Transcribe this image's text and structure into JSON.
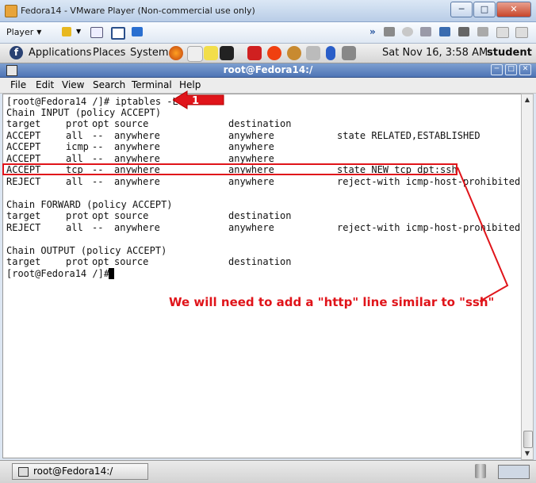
{
  "vm_window": {
    "title": "Fedora14 - VMware Player (Non-commercial use only)"
  },
  "vm_toolbar": {
    "player_label": "Player"
  },
  "panel": {
    "applications": "Applications",
    "places": "Places",
    "system": "System",
    "clock": "Sat Nov 16,  3:58 AM",
    "user": "student"
  },
  "terminal": {
    "title": "root@Fedora14:/",
    "menu": [
      "File",
      "Edit",
      "View",
      "Search",
      "Terminal",
      "Help"
    ],
    "command_line": "[root@Fedora14 /]# iptables -L",
    "prompt": "[root@Fedora14 /]# ",
    "chains": [
      {
        "header": "Chain INPUT (policy ACCEPT)",
        "columns": [
          "target",
          "prot",
          "opt",
          "source",
          "destination"
        ],
        "rows": [
          [
            "ACCEPT",
            "all",
            "--",
            "anywhere",
            "anywhere",
            "state RELATED,ESTABLISHED"
          ],
          [
            "ACCEPT",
            "icmp",
            "--",
            "anywhere",
            "anywhere",
            ""
          ],
          [
            "ACCEPT",
            "all",
            "--",
            "anywhere",
            "anywhere",
            ""
          ],
          [
            "ACCEPT",
            "tcp",
            "--",
            "anywhere",
            "anywhere",
            "state NEW tcp dpt:ssh"
          ],
          [
            "REJECT",
            "all",
            "--",
            "anywhere",
            "anywhere",
            "reject-with icmp-host-prohibited"
          ]
        ]
      },
      {
        "header": "Chain FORWARD (policy ACCEPT)",
        "columns": [
          "target",
          "prot",
          "opt",
          "source",
          "destination"
        ],
        "rows": [
          [
            "REJECT",
            "all",
            "--",
            "anywhere",
            "anywhere",
            "reject-with icmp-host-prohibited"
          ]
        ]
      },
      {
        "header": "Chain OUTPUT (policy ACCEPT)",
        "columns": [
          "target",
          "prot",
          "opt",
          "source",
          "destination"
        ],
        "rows": []
      }
    ]
  },
  "annotation": {
    "step": "1",
    "note": "We will need to add a \"http\" line similar to \"ssh\"",
    "color": "#e0141a"
  },
  "taskbar": {
    "window_label": "root@Fedora14:/"
  }
}
